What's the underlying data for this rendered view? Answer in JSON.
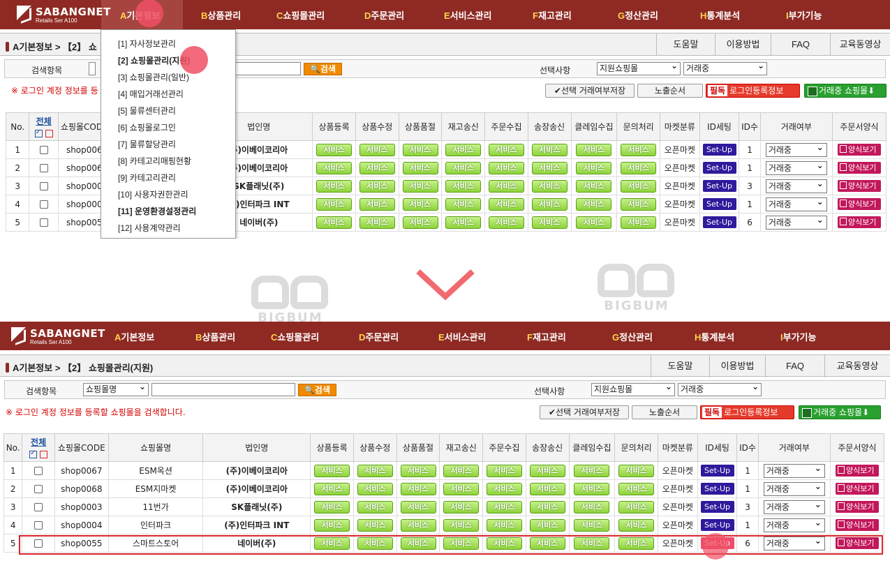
{
  "brand": {
    "name": "SABANGNET",
    "sub": "Retails Ser  A100"
  },
  "menu": [
    {
      "key": "A",
      "label": "기본정보"
    },
    {
      "key": "B",
      "label": "상품관리"
    },
    {
      "key": "C",
      "label": "쇼핑몰관리"
    },
    {
      "key": "D",
      "label": "주문관리"
    },
    {
      "key": "E",
      "label": "서비스관리"
    },
    {
      "key": "F",
      "label": "재고관리"
    },
    {
      "key": "G",
      "label": "정산관리"
    },
    {
      "key": "H",
      "label": "통계분석"
    },
    {
      "key": "I",
      "label": "부가기능"
    }
  ],
  "dropdown": [
    "[1] 자사정보관리",
    "[2] 쇼핑몰관리(지원)",
    "[3] 쇼핑몰관리(일반)",
    "[4] 매입거래선관리",
    "[5] 물류센터관리",
    "[6] 쇼핑몰로그인",
    "[7] 물류할당관리",
    "[8] 카테고리매핑현황",
    "[9] 카테고리관리",
    "[10] 사용자권한관리",
    "[11] 운영환경설정관리",
    "[12] 사용계약관리"
  ],
  "breadcrumb_top": "A기본정보 > 【2】 쇼",
  "breadcrumb": "A기본정보 > 【2】 쇼핑몰관리(지원)",
  "help": [
    "도움말",
    "이용방법",
    "FAQ",
    "교육동영상"
  ],
  "search": {
    "label": "검색항목",
    "field": "쇼핑몰명",
    "button": "검색",
    "select_label": "선택사항",
    "option1": "지원쇼핑몰",
    "option2": "거래중"
  },
  "notice_top": "※ 로그인 계정 정보를 등",
  "notice": "※ 로그인 계정 정보를 등록할 쇼핑몰을 검색합니다.",
  "toolbar": {
    "save": "선택 거래여부저장",
    "order": "노출순서",
    "required": "필독",
    "login_info": "로그인등록정보",
    "trading": "거래중 쇼핑몰"
  },
  "columns": [
    "No.",
    "전체",
    "쇼핑몰CODE",
    "쇼핑몰명",
    "법인명",
    "상품등록",
    "상품수정",
    "상품품절",
    "재고송신",
    "주문수집",
    "송장송신",
    "클레임수집",
    "문의처리",
    "마켓분류",
    "ID세팅",
    "ID수",
    "거래여부",
    "주문서양식"
  ],
  "service_label": "서비스",
  "setup_label": "Set-Up",
  "form_label": "양식보기",
  "rows": [
    {
      "no": "1",
      "code": "shop0067",
      "name": "ESM옥션",
      "corp": "(주)이베이코리아",
      "market": "오픈마켓",
      "ids": "1",
      "status": "거래중"
    },
    {
      "no": "2",
      "code": "shop0068",
      "name": "ESM지마켓",
      "corp": "(주)이베이코리아",
      "market": "오픈마켓",
      "ids": "1",
      "status": "거래중"
    },
    {
      "no": "3",
      "code": "shop0003",
      "name": "11번가",
      "corp": "SK플래닛(주)",
      "market": "오픈마켓",
      "ids": "3",
      "status": "거래중"
    },
    {
      "no": "4",
      "code": "shop0004",
      "name": "인터파크",
      "corp": "(주)인터파크 INT",
      "market": "오픈마켓",
      "ids": "1",
      "status": "거래중"
    },
    {
      "no": "5",
      "code": "shop0055",
      "name": "스마트스토어",
      "corp": "네이버(주)",
      "market": "오픈마켓",
      "ids": "6",
      "status": "거래중"
    }
  ],
  "top_rows": [
    {
      "no": "1",
      "code": "shop006",
      "corp": "주)이베이코리아",
      "market": "오픈마켓",
      "ids": "1",
      "status": "거래중"
    },
    {
      "no": "2",
      "code": "shop006",
      "corp": "주)이베이코리아",
      "market": "오픈마켓",
      "ids": "1",
      "status": "거래중"
    },
    {
      "no": "3",
      "code": "shop000",
      "corp": "SK플래닛(주)",
      "market": "오픈마켓",
      "ids": "3",
      "status": "거래중"
    },
    {
      "no": "4",
      "code": "shop000",
      "corp": "주)인터파크 INT",
      "market": "오픈마켓",
      "ids": "1",
      "status": "거래중"
    },
    {
      "no": "5",
      "code": "shop005",
      "corp": "네이버(주)",
      "market": "오픈마켓",
      "ids": "6",
      "status": "거래중"
    }
  ],
  "watermark": "BIGBUM",
  "colors": {
    "topbar": "#8e2a23",
    "highlight": "#ef4f6e",
    "service": "#8fd33c",
    "setup": "#2e1a9c"
  }
}
